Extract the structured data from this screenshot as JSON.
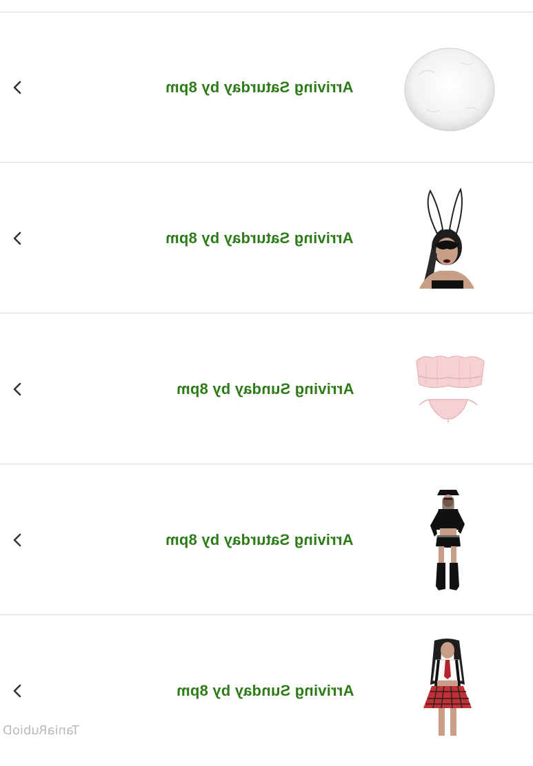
{
  "orders": [
    {
      "status": "Arriving Saturday by 8pm",
      "thumbnail": "white-pom-pom-tail"
    },
    {
      "status": "Arriving Saturday by 8pm",
      "thumbnail": "lace-bunny-ears-mask"
    },
    {
      "status": "Arriving Sunday by 8pm",
      "thumbnail": "pink-ruffle-lingerie-set"
    },
    {
      "status": "Arriving Saturday by 8pm",
      "thumbnail": "police-costume"
    },
    {
      "status": "Arriving Sunday by 8pm",
      "thumbnail": "schoolgirl-costume"
    }
  ],
  "status_color": "#2d7b18",
  "watermark": "TaniaRubioD",
  "chevron_icon": "chevron-left-icon"
}
